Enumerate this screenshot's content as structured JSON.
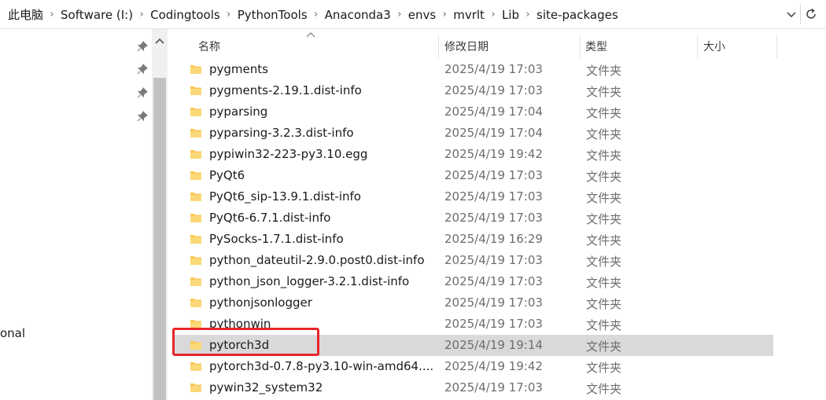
{
  "address_bar": {
    "path": [
      "此电脑",
      "Software (I:)",
      "Codingtools",
      "PythonTools",
      "Anaconda3",
      "envs",
      "mvrlt",
      "Lib",
      "site-packages"
    ],
    "chevron_icon": "chevron-down-icon",
    "refresh_icon": "refresh-icon"
  },
  "nav": {
    "partial_label": "onal",
    "pin_icon": "pin-icon"
  },
  "columns": {
    "name": "名称",
    "modified": "修改日期",
    "type": "类型",
    "size": "大小",
    "sort_column": "name"
  },
  "files": [
    {
      "name": "pygments",
      "modified": "2025/4/19 17:03",
      "type": "文件夹"
    },
    {
      "name": "pygments-2.19.1.dist-info",
      "modified": "2025/4/19 17:03",
      "type": "文件夹"
    },
    {
      "name": "pyparsing",
      "modified": "2025/4/19 17:04",
      "type": "文件夹"
    },
    {
      "name": "pyparsing-3.2.3.dist-info",
      "modified": "2025/4/19 17:04",
      "type": "文件夹"
    },
    {
      "name": "pypiwin32-223-py3.10.egg",
      "modified": "2025/4/19 19:42",
      "type": "文件夹"
    },
    {
      "name": "PyQt6",
      "modified": "2025/4/19 17:03",
      "type": "文件夹"
    },
    {
      "name": "PyQt6_sip-13.9.1.dist-info",
      "modified": "2025/4/19 17:03",
      "type": "文件夹"
    },
    {
      "name": "PyQt6-6.7.1.dist-info",
      "modified": "2025/4/19 17:03",
      "type": "文件夹"
    },
    {
      "name": "PySocks-1.7.1.dist-info",
      "modified": "2025/4/19 16:29",
      "type": "文件夹"
    },
    {
      "name": "python_dateutil-2.9.0.post0.dist-info",
      "modified": "2025/4/19 17:03",
      "type": "文件夹"
    },
    {
      "name": "python_json_logger-3.2.1.dist-info",
      "modified": "2025/4/19 17:03",
      "type": "文件夹"
    },
    {
      "name": "pythonjsonlogger",
      "modified": "2025/4/19 17:03",
      "type": "文件夹"
    },
    {
      "name": "pythonwin",
      "modified": "2025/4/19 17:03",
      "type": "文件夹"
    },
    {
      "name": "pytorch3d",
      "modified": "2025/4/19 19:14",
      "type": "文件夹",
      "selected": true,
      "highlighted": true
    },
    {
      "name": "pytorch3d-0.7.8-py3.10-win-amd64....",
      "modified": "2025/4/19 19:42",
      "type": "文件夹"
    },
    {
      "name": "pywin32_system32",
      "modified": "2025/4/19 17:03",
      "type": "文件夹"
    }
  ],
  "colors": {
    "selected_row": "#d9d9d9",
    "highlight_box": "#e8262b",
    "folder": "#f8c95a"
  }
}
